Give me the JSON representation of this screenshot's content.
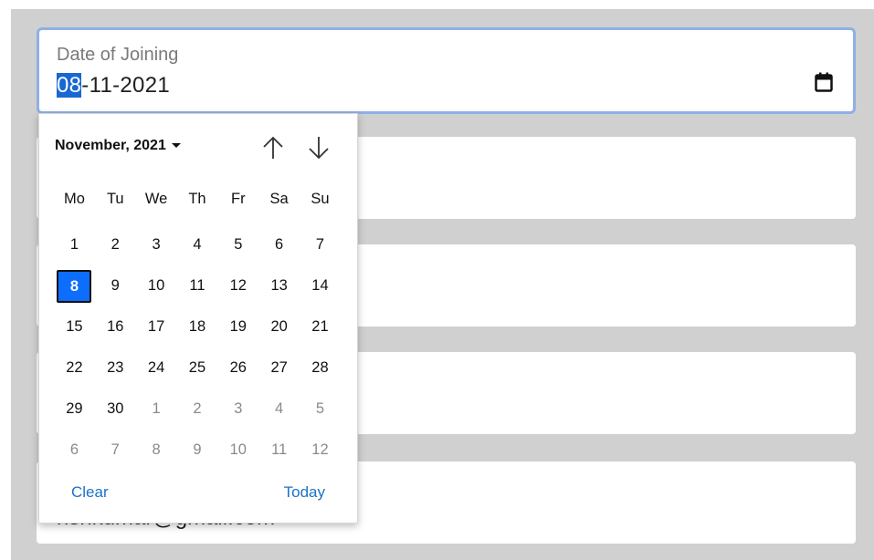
{
  "date_field": {
    "label": "Date of Joining",
    "value_selected": "08",
    "value_rest": "-11-2021",
    "icon": "calendar-icon"
  },
  "email_field": {
    "value": "rishkumar@gmail.com"
  },
  "datepicker": {
    "month_label": "November, 2021",
    "weekdays": [
      "Mo",
      "Tu",
      "We",
      "Th",
      "Fr",
      "Sa",
      "Su"
    ],
    "weeks": [
      [
        {
          "d": "1"
        },
        {
          "d": "2"
        },
        {
          "d": "3"
        },
        {
          "d": "4"
        },
        {
          "d": "5"
        },
        {
          "d": "6"
        },
        {
          "d": "7"
        }
      ],
      [
        {
          "d": "8",
          "selected": true
        },
        {
          "d": "9"
        },
        {
          "d": "10"
        },
        {
          "d": "11"
        },
        {
          "d": "12"
        },
        {
          "d": "13"
        },
        {
          "d": "14"
        }
      ],
      [
        {
          "d": "15"
        },
        {
          "d": "16"
        },
        {
          "d": "17"
        },
        {
          "d": "18"
        },
        {
          "d": "19"
        },
        {
          "d": "20"
        },
        {
          "d": "21"
        }
      ],
      [
        {
          "d": "22"
        },
        {
          "d": "23"
        },
        {
          "d": "24"
        },
        {
          "d": "25"
        },
        {
          "d": "26"
        },
        {
          "d": "27"
        },
        {
          "d": "28"
        }
      ],
      [
        {
          "d": "29"
        },
        {
          "d": "30"
        },
        {
          "d": "1",
          "muted": true
        },
        {
          "d": "2",
          "muted": true
        },
        {
          "d": "3",
          "muted": true
        },
        {
          "d": "4",
          "muted": true
        },
        {
          "d": "5",
          "muted": true
        }
      ],
      [
        {
          "d": "6",
          "muted": true
        },
        {
          "d": "7",
          "muted": true
        },
        {
          "d": "8",
          "muted": true
        },
        {
          "d": "9",
          "muted": true
        },
        {
          "d": "10",
          "muted": true
        },
        {
          "d": "11",
          "muted": true
        },
        {
          "d": "12",
          "muted": true
        }
      ]
    ],
    "clear_label": "Clear",
    "today_label": "Today",
    "icons": {
      "prev": "arrow-up-icon",
      "next": "arrow-down-icon",
      "dropdown": "caret-down-icon"
    }
  },
  "colors": {
    "selected_day": "#0d6efd",
    "link": "#1a73c8",
    "focus_border": "#8fb0e6",
    "background_panel": "#d0d0d0"
  }
}
